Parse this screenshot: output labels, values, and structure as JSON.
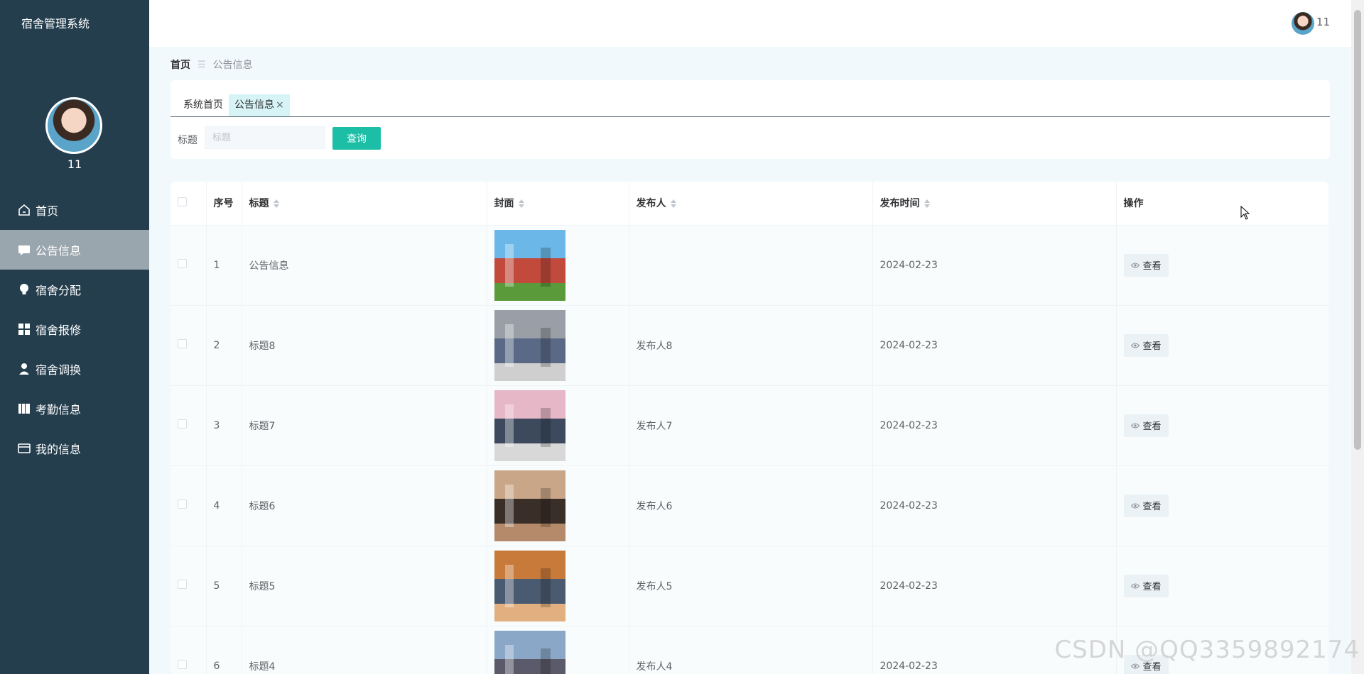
{
  "app": {
    "title": "宿舍管理系统"
  },
  "user": {
    "name": "11"
  },
  "sidebar": {
    "items": [
      {
        "label": "首页",
        "icon": "home-icon"
      },
      {
        "label": "公告信息",
        "icon": "notice-icon",
        "active": true
      },
      {
        "label": "宿舍分配",
        "icon": "lightbulb-icon"
      },
      {
        "label": "宿舍报修",
        "icon": "grid-icon"
      },
      {
        "label": "宿舍调换",
        "icon": "user-icon"
      },
      {
        "label": "考勤信息",
        "icon": "book-icon"
      },
      {
        "label": "我的信息",
        "icon": "card-icon"
      }
    ]
  },
  "breadcrumb": {
    "home": "首页",
    "separator": "☰",
    "current": "公告信息"
  },
  "tabs": [
    {
      "label": "系统首页"
    },
    {
      "label": "公告信息",
      "active": true,
      "close": "×"
    }
  ],
  "search": {
    "label": "标题",
    "placeholder": "标题",
    "value": "",
    "button": "查询"
  },
  "table": {
    "headers": [
      "序号",
      "标题",
      "封面",
      "发布人",
      "发布时间",
      "操作"
    ],
    "view_label": "查看",
    "rows": [
      {
        "no": "1",
        "title": "公告信息",
        "publisher": "",
        "time": "2024-02-23"
      },
      {
        "no": "2",
        "title": "标题8",
        "publisher": "发布人8",
        "time": "2024-02-23"
      },
      {
        "no": "3",
        "title": "标题7",
        "publisher": "发布人7",
        "time": "2024-02-23"
      },
      {
        "no": "4",
        "title": "标题6",
        "publisher": "发布人6",
        "time": "2024-02-23"
      },
      {
        "no": "5",
        "title": "标题5",
        "publisher": "发布人5",
        "time": "2024-02-23"
      },
      {
        "no": "6",
        "title": "标题4",
        "publisher": "发布人4",
        "time": "2024-02-23"
      }
    ]
  },
  "watermark": "CSDN @QQ3359892174",
  "colors": {
    "sidebar": "#243e4e",
    "accent": "#1cbea6",
    "active_menu": "#9aa6ad",
    "page_bg": "#f2f9fc"
  }
}
